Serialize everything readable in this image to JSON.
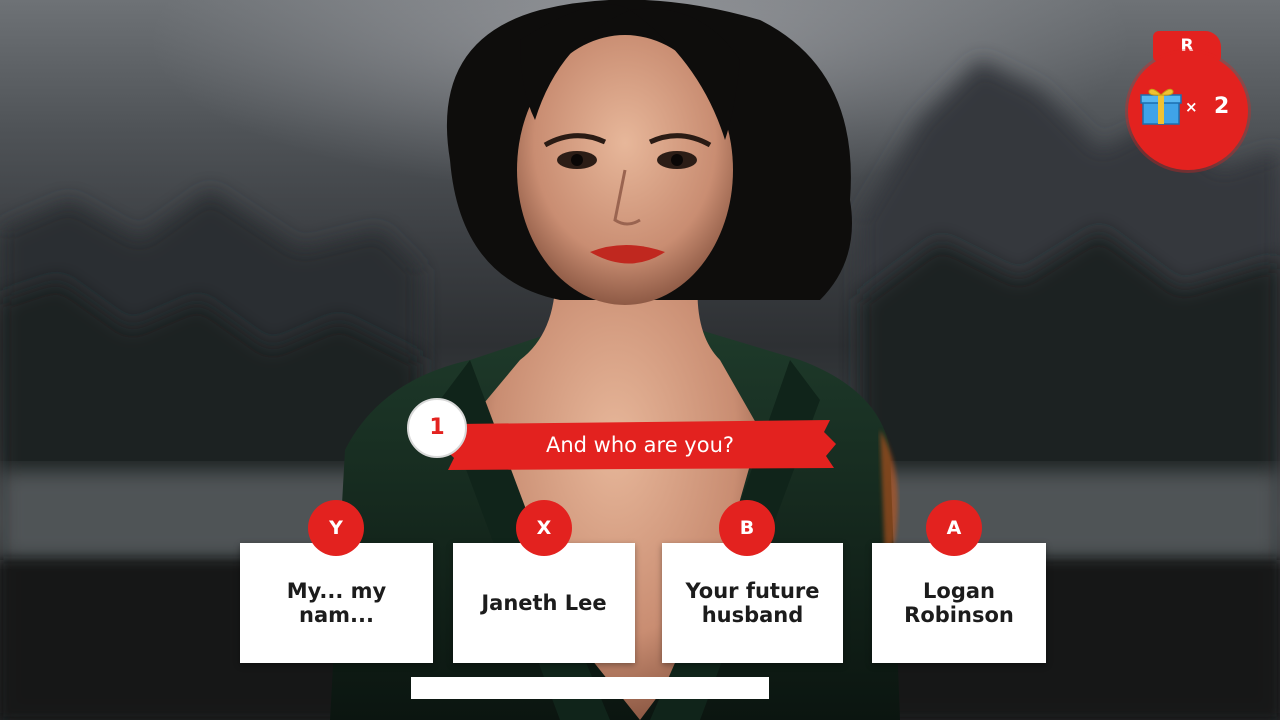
{
  "hud": {
    "gift_key": "R",
    "gift_icon": "gift-box-icon",
    "gift_multiplier": "×",
    "gift_count": "2"
  },
  "question": {
    "number": "1",
    "text": "And who are you?"
  },
  "answers": [
    {
      "key": "Y",
      "text": "My... my nam..."
    },
    {
      "key": "X",
      "text": "Janeth Lee"
    },
    {
      "key": "B",
      "text": "Your future\nhusband"
    },
    {
      "key": "A",
      "text": "Logan\nRobinson"
    }
  ],
  "timer": {
    "remaining_fraction": 1.0
  },
  "colors": {
    "accent": "#e3221f",
    "card": "#ffffff",
    "card_text": "#1c1c1c"
  }
}
